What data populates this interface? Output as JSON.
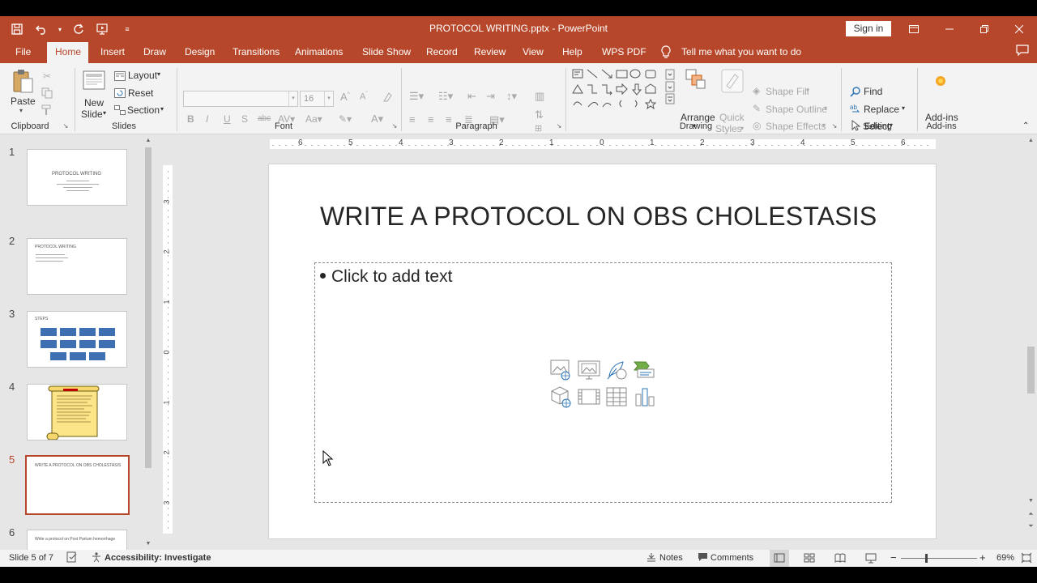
{
  "window": {
    "title": "PROTOCOL WRITING.pptx  -  PowerPoint",
    "signin_label": "Sign in"
  },
  "accent_color": "#b7472a",
  "tabs": [
    {
      "label": "File"
    },
    {
      "label": "Home"
    },
    {
      "label": "Insert"
    },
    {
      "label": "Draw"
    },
    {
      "label": "Design"
    },
    {
      "label": "Transitions"
    },
    {
      "label": "Animations"
    },
    {
      "label": "Slide Show"
    },
    {
      "label": "Record"
    },
    {
      "label": "Review"
    },
    {
      "label": "View"
    },
    {
      "label": "Help"
    },
    {
      "label": "WPS PDF"
    }
  ],
  "tell_me": "Tell me what you want to do",
  "ribbon": {
    "clipboard": {
      "paste": "Paste",
      "label": "Clipboard"
    },
    "slides": {
      "new_slide_1": "New",
      "new_slide_2": "Slide",
      "layout": "Layout",
      "reset": "Reset",
      "section": "Section",
      "label": "Slides"
    },
    "font": {
      "size": "16",
      "label": "Font"
    },
    "paragraph": {
      "label": "Paragraph"
    },
    "drawing": {
      "arrange": "Arrange",
      "quick_styles_1": "Quick",
      "quick_styles_2": "Styles",
      "shape_fill": "Shape Fill",
      "shape_outline": "Shape Outline",
      "shape_effects": "Shape Effects",
      "label": "Drawing"
    },
    "editing": {
      "find": "Find",
      "replace": "Replace",
      "select": "Select",
      "label": "Editing"
    },
    "addins": {
      "button": "Add-ins",
      "label": "Add-ins"
    }
  },
  "thumbnails": [
    {
      "num": "1",
      "title": "PROTOCOL WRITING"
    },
    {
      "num": "2",
      "title": "PROTOCOL WRITING"
    },
    {
      "num": "3",
      "title": "STEPS"
    },
    {
      "num": "4",
      "title": ""
    },
    {
      "num": "5",
      "title": "WRITE A PROTOCOL ON OBS CHOLESTASIS"
    },
    {
      "num": "6",
      "title": "Write a protocol on Post Partum hemorrhage"
    }
  ],
  "ruler": {
    "h_labels": [
      "6",
      "5",
      "4",
      "3",
      "2",
      "1",
      "0",
      "1",
      "2",
      "3",
      "4",
      "5",
      "6"
    ],
    "v_labels": [
      "3",
      "2",
      "1",
      "0",
      "1",
      "2",
      "3"
    ]
  },
  "slide": {
    "title": "WRITE A PROTOCOL ON OBS CHOLESTASIS",
    "placeholder_text": "Click to add text"
  },
  "status": {
    "slide_info": "Slide 5 of 7",
    "accessibility": "Accessibility: Investigate",
    "notes": "Notes",
    "comments": "Comments",
    "zoom": "69%"
  }
}
